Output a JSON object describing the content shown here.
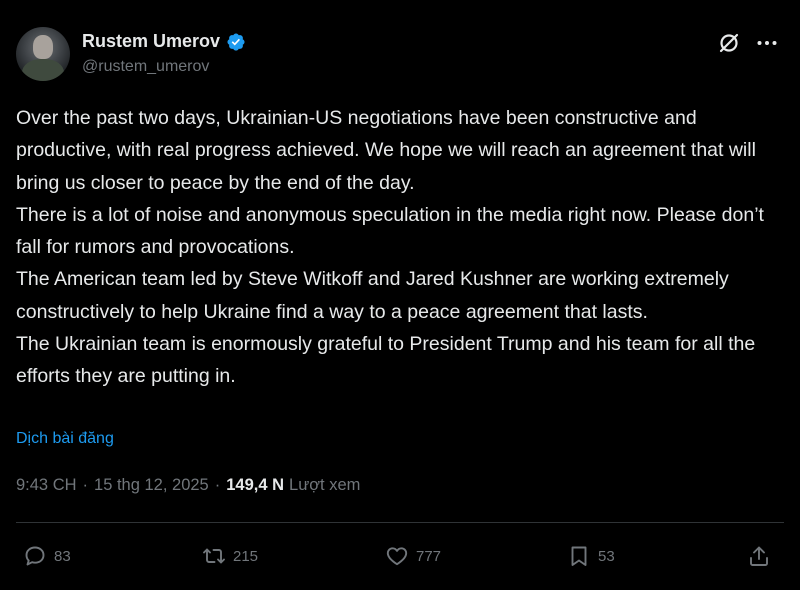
{
  "author": {
    "name": "Rustem Umerov",
    "handle": "@rustem_umerov",
    "verified_icon": "verified-badge-icon"
  },
  "tweet": {
    "paragraphs": [
      "Over the past two days, Ukrainian-US negotiations have been constructive and productive, with real progress achieved. We hope we will reach an agreement that will bring us closer to peace by the end of the day.",
      "There is a lot of noise and anonymous speculation in the media right now. Please don’t fall for rumors and provocations.",
      "The American team led by Steve Witkoff and Jared Kushner are working extremely constructively to help Ukraine find a way to a peace agreement that lasts.",
      "The Ukrainian team is enormously grateful to President Trump and his team for all the efforts they are putting in."
    ],
    "translate_label": "Dịch bài đăng"
  },
  "meta": {
    "time": "9:43 CH",
    "separator": "·",
    "date": "15 thg 12, 2025",
    "views_count": "149,4 N",
    "views_label": "Lượt xem"
  },
  "actions": {
    "replies": "83",
    "reposts": "215",
    "likes": "777",
    "bookmarks": "53"
  },
  "colors": {
    "background": "#000000",
    "text": "#e7e9ea",
    "muted": "#71767b",
    "link": "#1d9bf0",
    "verified": "#1d9bf0"
  }
}
